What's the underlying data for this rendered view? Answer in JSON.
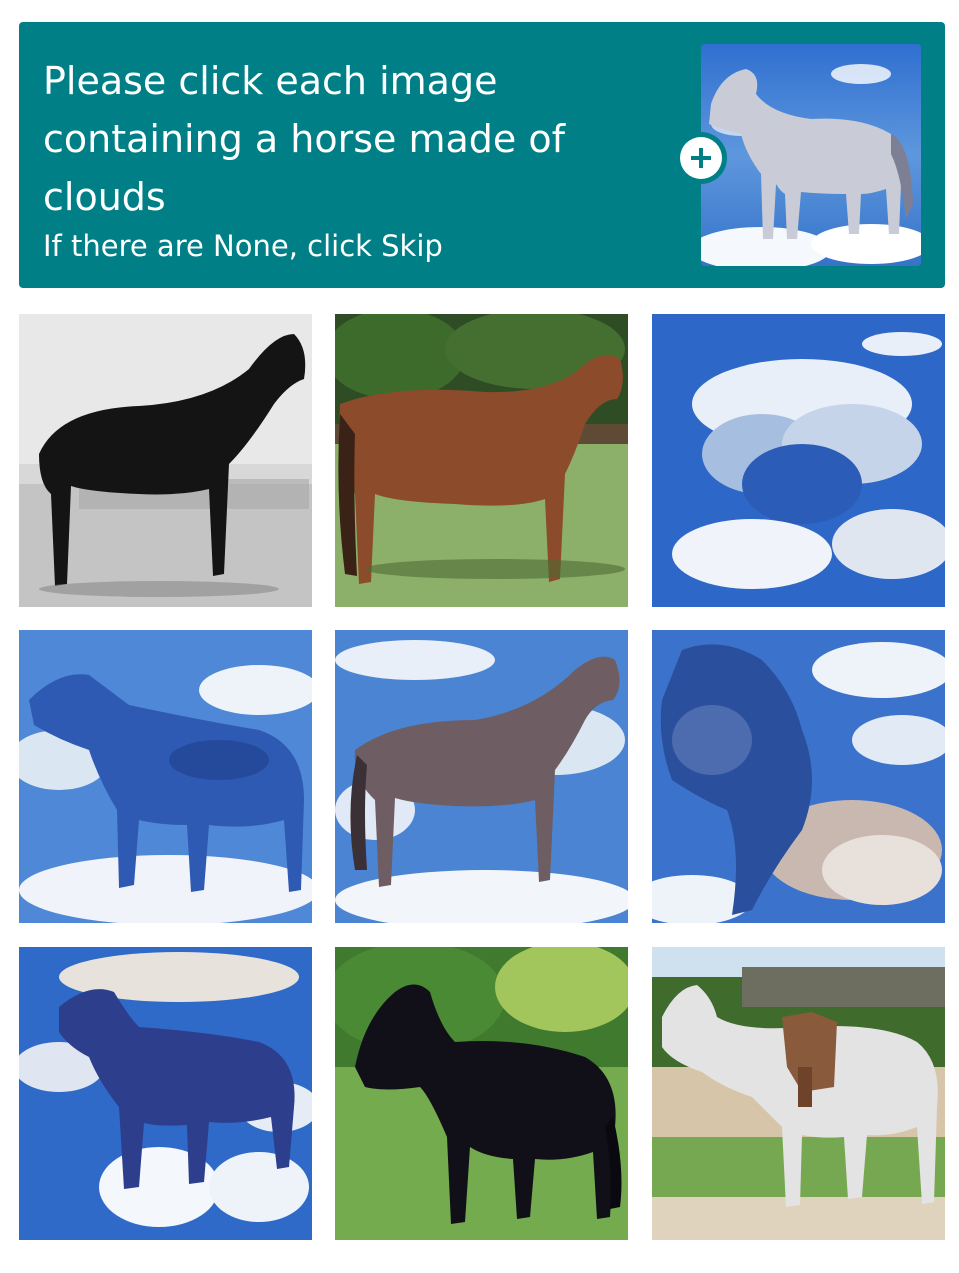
{
  "header": {
    "title": "Please click each image containing a horse made of clouds",
    "subtitle": "If there are None, click Skip",
    "background_color": "#007f87",
    "example_image": "cloud-horse-example",
    "expand_icon": "plus-icon"
  },
  "grid": {
    "rows": 3,
    "columns": 3,
    "tiles": [
      {
        "subject": "black-and-white-photo-black-horse"
      },
      {
        "subject": "brown-horse-on-grass"
      },
      {
        "subject": "clouds-blue-sky"
      },
      {
        "subject": "blue-cloud-horse"
      },
      {
        "subject": "brown-horse-among-clouds"
      },
      {
        "subject": "cloud-horse-head"
      },
      {
        "subject": "dark-cloud-horse"
      },
      {
        "subject": "black-horse-on-grass"
      },
      {
        "subject": "white-horse-with-saddle"
      }
    ]
  }
}
